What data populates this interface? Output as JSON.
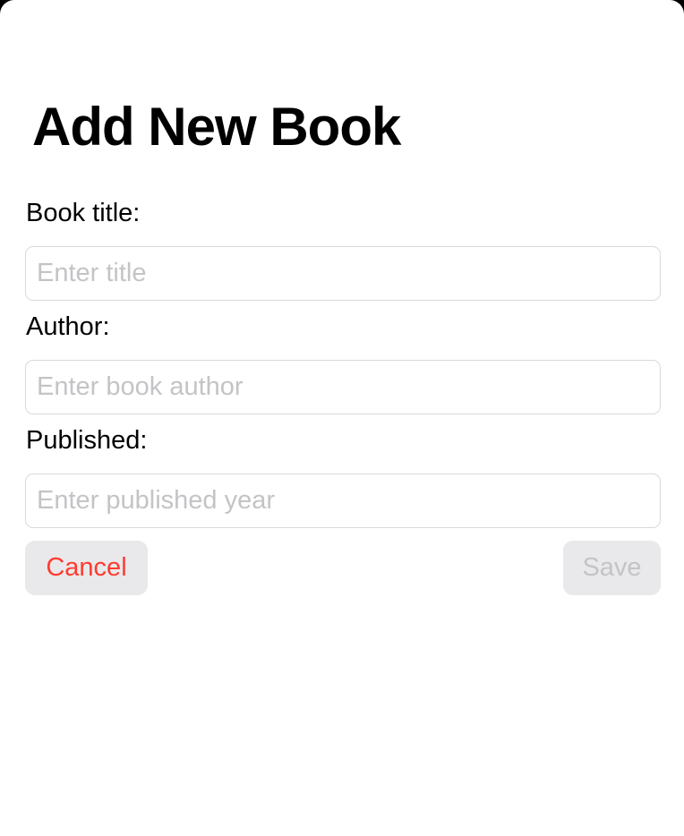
{
  "dialog": {
    "title": "Add New Book"
  },
  "form": {
    "title_field": {
      "label": "Book title:",
      "value": "",
      "placeholder": "Enter title"
    },
    "author_field": {
      "label": "Author:",
      "value": "",
      "placeholder": "Enter book author"
    },
    "published_field": {
      "label": "Published:",
      "value": "",
      "placeholder": "Enter published year"
    }
  },
  "actions": {
    "cancel_label": "Cancel",
    "save_label": "Save"
  },
  "colors": {
    "cancel_text": "#ff3b30",
    "save_text_disabled": "#c4c4c7",
    "button_background": "#e9e9eb"
  }
}
